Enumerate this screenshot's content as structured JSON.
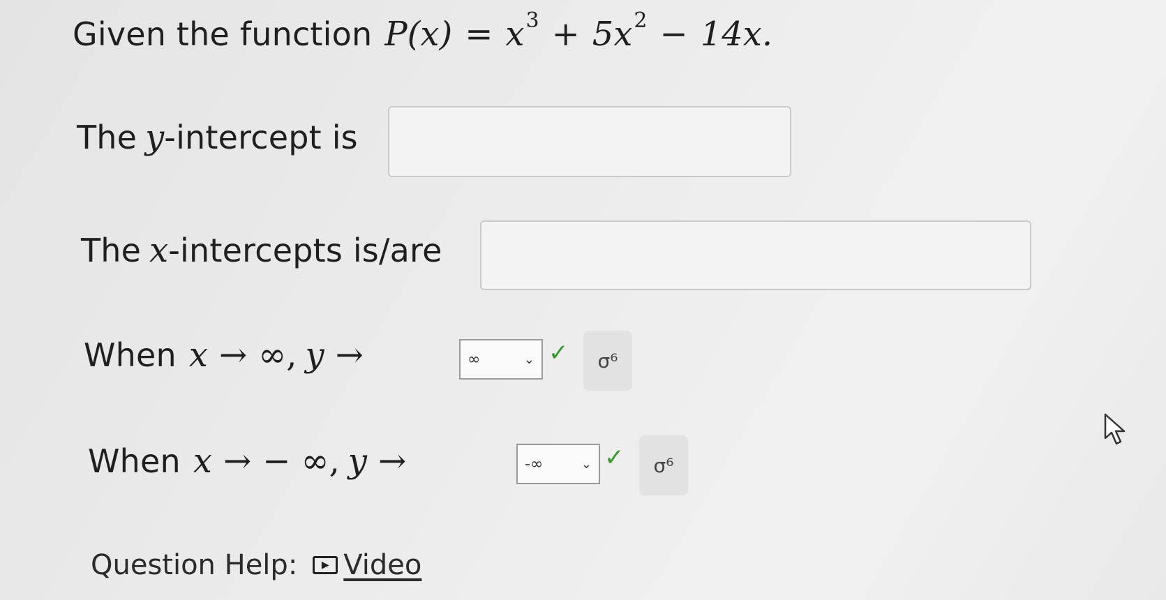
{
  "question": {
    "prefix": "Given the function",
    "function_lhs": "P(x)",
    "equals": "=",
    "term1_base": "x",
    "term1_exp": "3",
    "plus": "+",
    "term2_coef": "5x",
    "term2_exp": "2",
    "minus": "−",
    "term3": "14x."
  },
  "y_intercept": {
    "label_pre": "The",
    "var": "y",
    "label_post": "-intercept is",
    "value": ""
  },
  "x_intercepts": {
    "label_pre": "The",
    "var": "x",
    "label_post": "-intercepts is/are",
    "value": ""
  },
  "end_behavior_pos": {
    "when": "When",
    "x": "x",
    "arrow": "→",
    "limit": "∞,",
    "y": "y",
    "arrow2": "→",
    "selected": "∞",
    "chevron": "⌄",
    "check": "✓",
    "icon": "σ⁶"
  },
  "end_behavior_neg": {
    "when": "When",
    "x": "x",
    "arrow": "→",
    "limit": "− ∞,",
    "y": "y",
    "arrow2": "→",
    "selected": "-∞",
    "chevron": "⌄",
    "check": "✓",
    "icon": "σ⁶"
  },
  "help": {
    "label": "Question Help:",
    "video_icon": "▶",
    "video_label": "Video"
  },
  "colors": {
    "check": "#3a9a2e",
    "text": "#1f1f1f",
    "box_border": "#c9c9c9"
  }
}
